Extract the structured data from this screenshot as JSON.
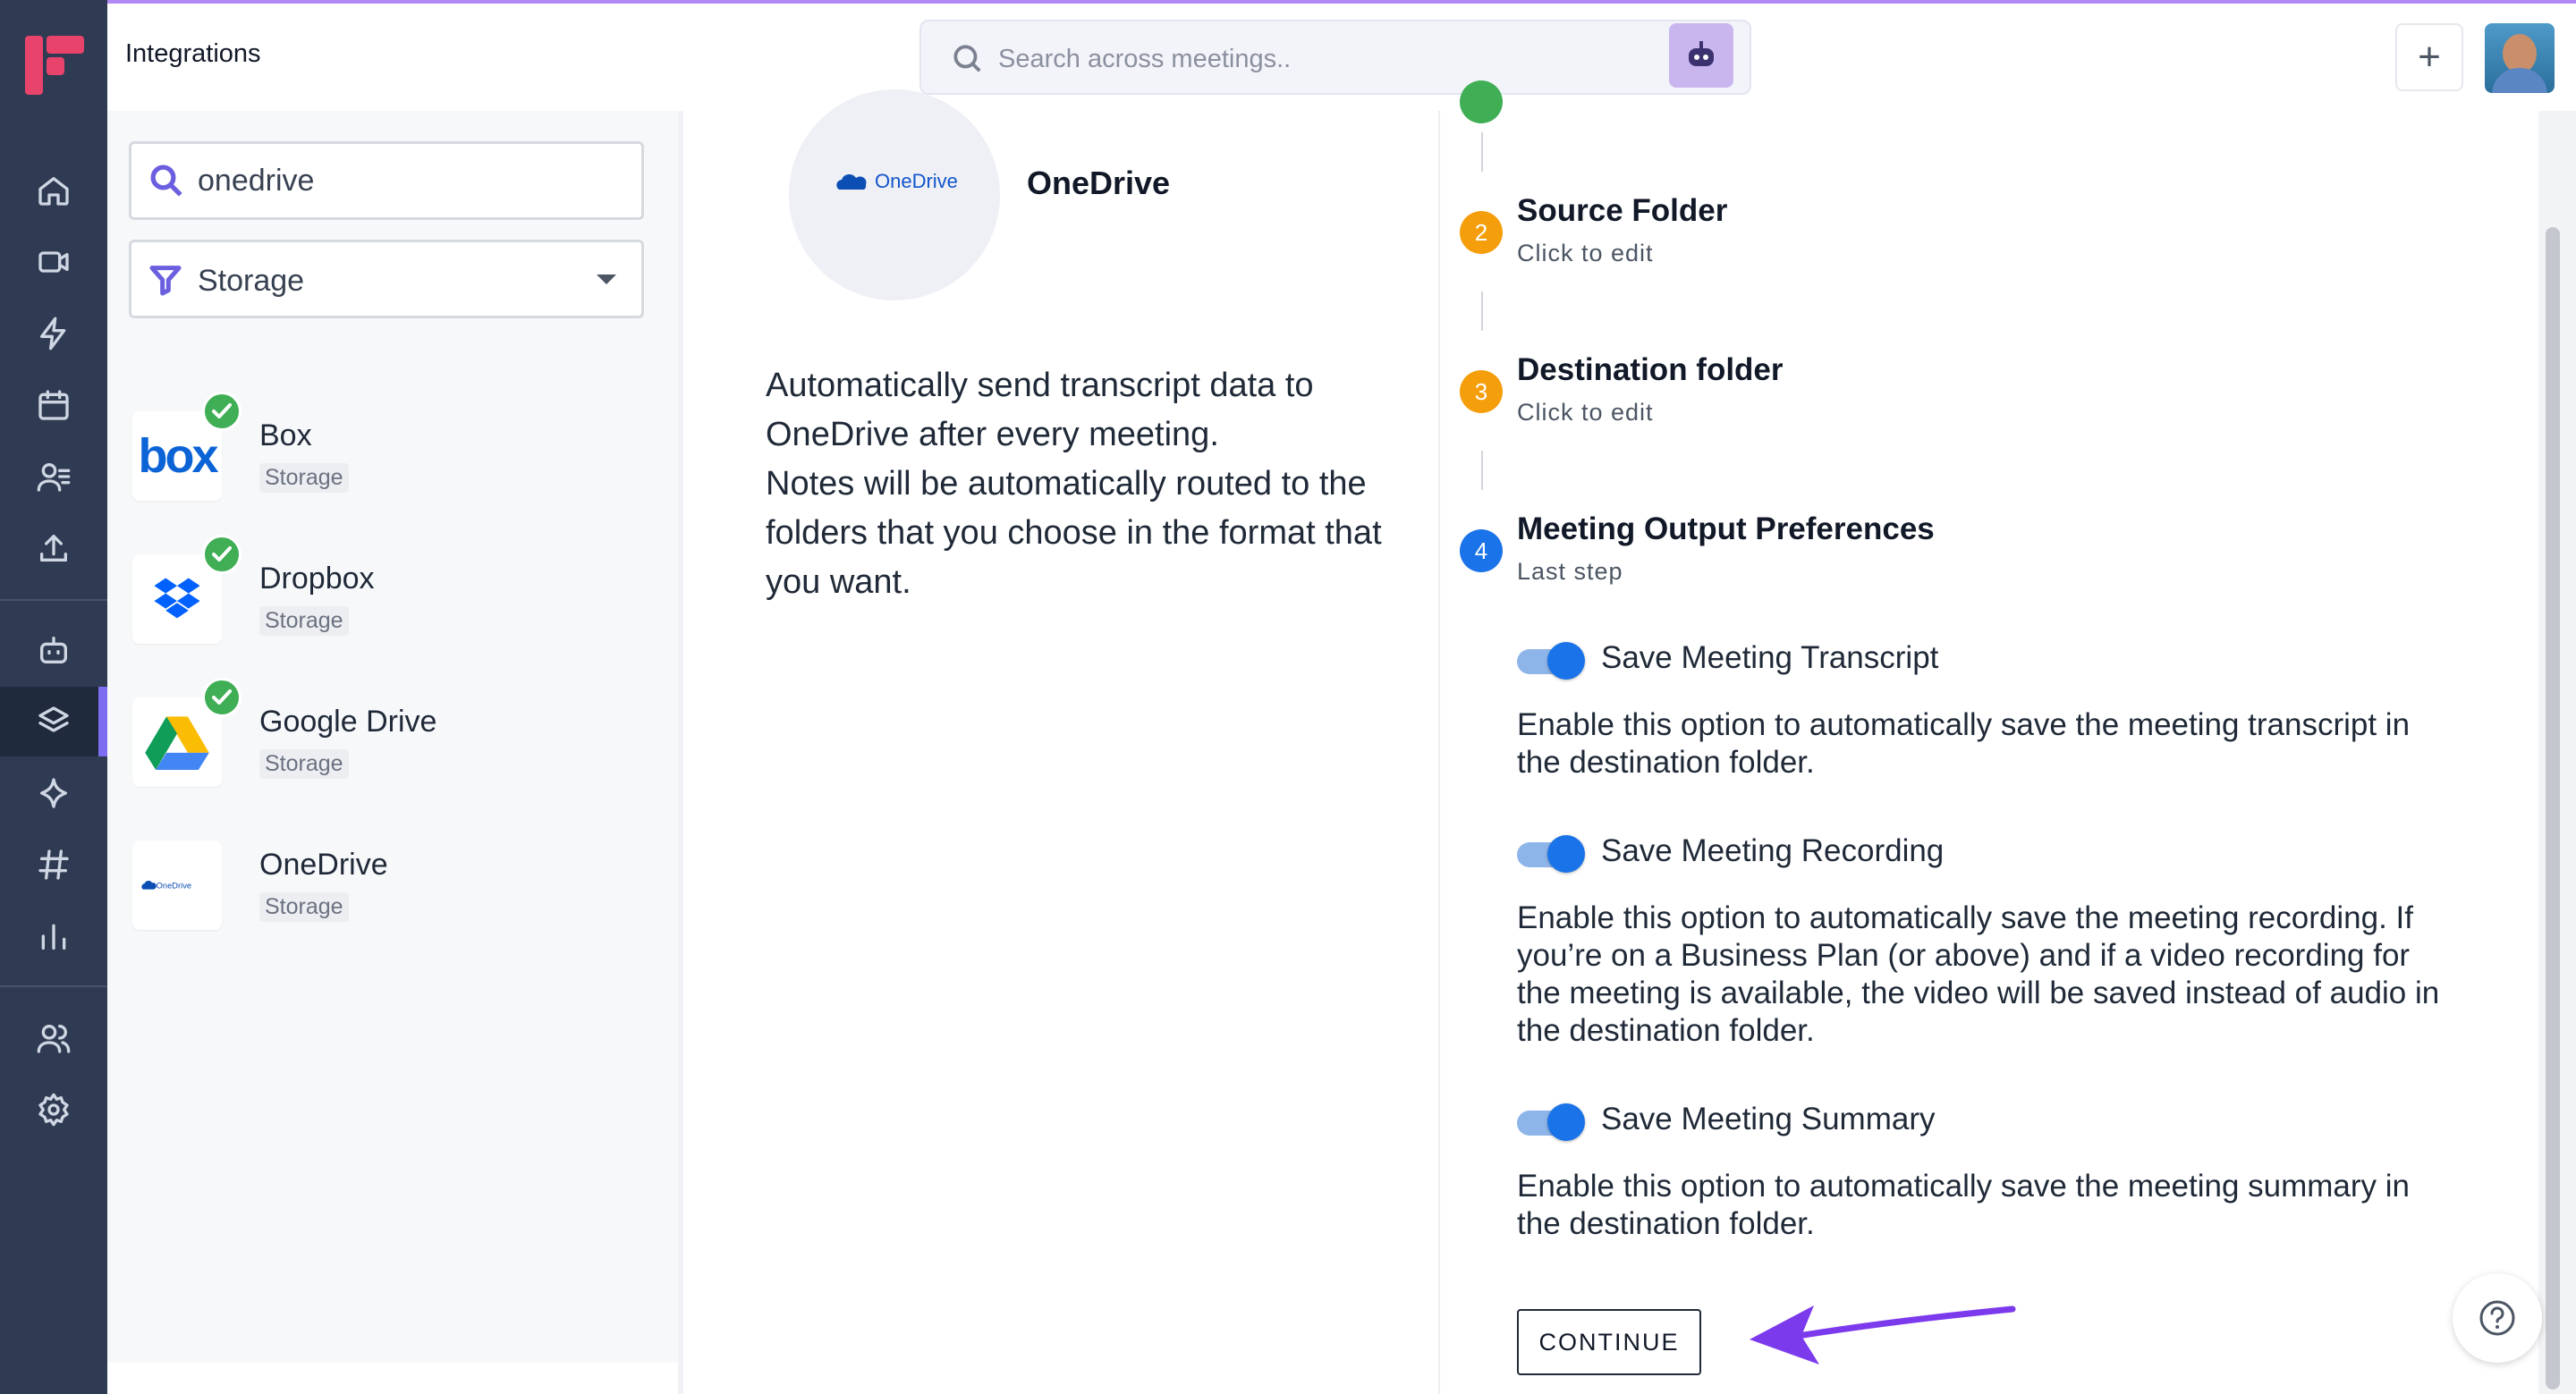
{
  "app": {
    "page_title": "Integrations",
    "accent_color": "#7c3aed",
    "rail_icons": [
      "home-icon",
      "video-icon",
      "bolt-icon",
      "calendar-icon",
      "contacts-icon",
      "upload-icon",
      "bot-icon",
      "layers-icon",
      "sparkle-icon",
      "hashtag-icon",
      "analytics-icon",
      "team-icon",
      "settings-icon"
    ]
  },
  "header": {
    "search_placeholder": "Search across meetings..",
    "add_label": "+"
  },
  "list": {
    "search_value": "onedrive",
    "category_value": "Storage",
    "items": [
      {
        "name": "Box",
        "category": "Storage",
        "connected": true
      },
      {
        "name": "Dropbox",
        "category": "Storage",
        "connected": true
      },
      {
        "name": "Google Drive",
        "category": "Storage",
        "connected": true
      },
      {
        "name": "OneDrive",
        "category": "Storage",
        "connected": false
      }
    ]
  },
  "detail": {
    "logo_text": "OneDrive",
    "title": "OneDrive",
    "description_line1": "Automatically send transcript data to OneDrive after every meeting.",
    "description_line2": "Notes will be automatically routed to the folders that you choose in the format that you want."
  },
  "steps": {
    "items": [
      {
        "number": "2",
        "title": "Source Folder",
        "subtitle": "Click to edit",
        "color": "#f59e0b"
      },
      {
        "number": "3",
        "title": "Destination folder",
        "subtitle": "Click to edit",
        "color": "#f59e0b"
      },
      {
        "number": "4",
        "title": "Meeting Output Preferences",
        "subtitle": "Last step",
        "color": "#1a73e8"
      }
    ],
    "options": [
      {
        "label": "Save Meeting Transcript",
        "enabled": true,
        "description": "Enable this option to automatically save the meeting transcript in the destination folder."
      },
      {
        "label": "Save Meeting Recording",
        "enabled": true,
        "description": "Enable this option to automatically save the meeting recording. If you’re on a Business Plan (or above) and if a video recording for the meeting is available, the video will be saved instead of audio in the destination folder."
      },
      {
        "label": "Save Meeting Summary",
        "enabled": true,
        "description": "Enable this option to automatically save the meeting summary in the destination folder."
      }
    ],
    "continue_label": "CONTINUE"
  }
}
